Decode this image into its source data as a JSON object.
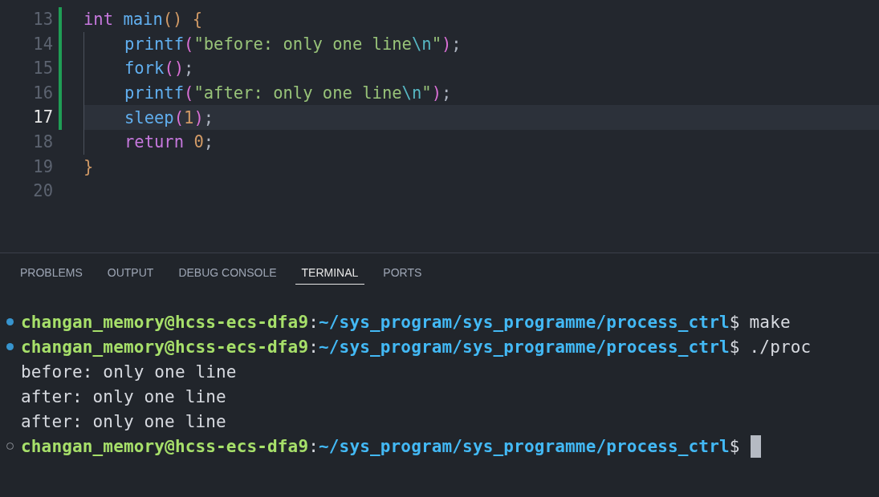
{
  "editor": {
    "lines": [
      {
        "number": "13",
        "current": false,
        "modified": true,
        "indent": false,
        "tokens": [
          {
            "kind": "keyword",
            "text": "int "
          },
          {
            "kind": "function",
            "text": "main"
          },
          {
            "kind": "bracket1",
            "text": "() {"
          }
        ]
      },
      {
        "number": "14",
        "current": false,
        "modified": true,
        "indent": true,
        "tokens": [
          {
            "kind": "function",
            "text": "printf"
          },
          {
            "kind": "bracket2",
            "text": "("
          },
          {
            "kind": "string",
            "text": "\"before: only one line"
          },
          {
            "kind": "escape",
            "text": "\\n"
          },
          {
            "kind": "string",
            "text": "\""
          },
          {
            "kind": "bracket2",
            "text": ")"
          },
          {
            "kind": "plain",
            "text": ";"
          }
        ]
      },
      {
        "number": "15",
        "current": false,
        "modified": true,
        "indent": true,
        "tokens": [
          {
            "kind": "function",
            "text": "fork"
          },
          {
            "kind": "bracket2",
            "text": "()"
          },
          {
            "kind": "plain",
            "text": ";"
          }
        ]
      },
      {
        "number": "16",
        "current": false,
        "modified": true,
        "indent": true,
        "tokens": [
          {
            "kind": "function",
            "text": "printf"
          },
          {
            "kind": "bracket2",
            "text": "("
          },
          {
            "kind": "string",
            "text": "\"after: only one line"
          },
          {
            "kind": "escape",
            "text": "\\n"
          },
          {
            "kind": "string",
            "text": "\""
          },
          {
            "kind": "bracket2",
            "text": ")"
          },
          {
            "kind": "plain",
            "text": ";"
          }
        ]
      },
      {
        "number": "17",
        "current": true,
        "modified": true,
        "indent": true,
        "tokens": [
          {
            "kind": "function",
            "text": "sleep"
          },
          {
            "kind": "bracket2",
            "text": "("
          },
          {
            "kind": "number",
            "text": "1"
          },
          {
            "kind": "bracket2",
            "text": ")"
          },
          {
            "kind": "plain",
            "text": ";"
          }
        ]
      },
      {
        "number": "18",
        "current": false,
        "modified": false,
        "indent": true,
        "tokens": [
          {
            "kind": "keyword",
            "text": "return "
          },
          {
            "kind": "number",
            "text": "0"
          },
          {
            "kind": "plain",
            "text": ";"
          }
        ]
      },
      {
        "number": "19",
        "current": false,
        "modified": false,
        "indent": false,
        "tokens": [
          {
            "kind": "bracket1",
            "text": "}"
          }
        ]
      },
      {
        "number": "20",
        "current": false,
        "modified": false,
        "indent": false
      }
    ]
  },
  "panel": {
    "tabs": [
      {
        "label": "PROBLEMS",
        "selected": false
      },
      {
        "label": "OUTPUT",
        "selected": false
      },
      {
        "label": "DEBUG CONSOLE",
        "selected": false
      },
      {
        "label": "TERMINAL",
        "selected": true
      },
      {
        "label": "PORTS",
        "selected": false
      }
    ],
    "terminal": {
      "lines": [
        {
          "kind": "prompt",
          "finished": true,
          "user_host": "changan_memory@hcss-ecs-dfa9",
          "separator": ":",
          "path": "~/sys_program/sys_programme/process_ctrl",
          "symbol": "$",
          "command": "make"
        },
        {
          "kind": "prompt",
          "finished": true,
          "user_host": "changan_memory@hcss-ecs-dfa9",
          "separator": ":",
          "path": "~/sys_program/sys_programme/process_ctrl",
          "symbol": "$",
          "command": "./proc"
        },
        {
          "kind": "output",
          "text": "before: only one line"
        },
        {
          "kind": "output",
          "text": "after: only one line"
        },
        {
          "kind": "output",
          "text": "after: only one line"
        },
        {
          "kind": "prompt",
          "finished": false,
          "user_host": "changan_memory@hcss-ecs-dfa9",
          "separator": ":",
          "path": "~/sys_program/sys_programme/process_ctrl",
          "symbol": "$",
          "cursor": true
        }
      ]
    }
  }
}
